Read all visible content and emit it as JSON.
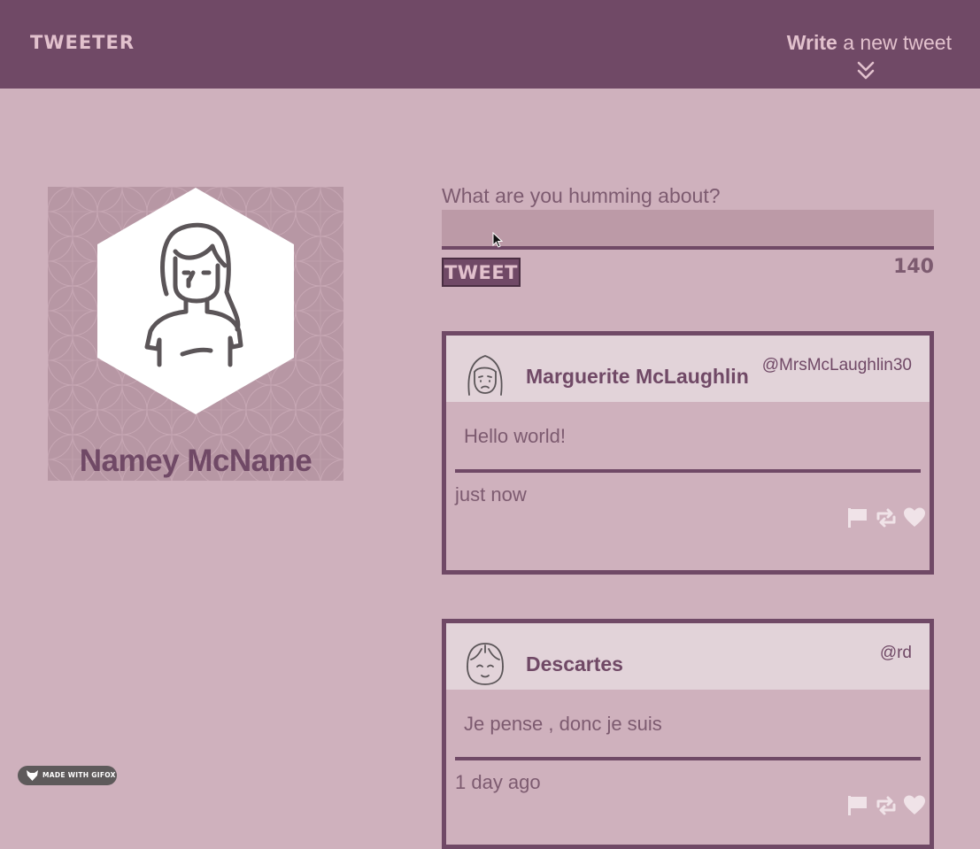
{
  "navbar": {
    "brand": "TWEETER",
    "compose_bold": "Write",
    "compose_rest": " a new tweet",
    "compose_icon": "double-chevron-down-icon"
  },
  "profile": {
    "name": "Namey McName",
    "avatar_icon": "woman-avatar-icon"
  },
  "composer": {
    "label": "What are you humming about?",
    "input_value": "",
    "button_label": "TWEET",
    "counter": "140"
  },
  "tweets": [
    {
      "name": "Marguerite McLaughlin",
      "handle": "@MrsMcLaughlin30",
      "text": "Hello world!",
      "time": "just now",
      "avatar_icon": "sad-woman-avatar-icon"
    },
    {
      "name": "Descartes",
      "handle": "@rd",
      "text": "Je pense , donc je suis",
      "time": "1 day ago",
      "avatar_icon": "smiling-child-avatar-icon"
    }
  ],
  "tweet_actions": [
    "flag-icon",
    "retweet-icon",
    "heart-icon"
  ],
  "badge": {
    "label": "MADE WITH GIFOX"
  },
  "colors": {
    "page_bg": "#cfb1bd",
    "navbar_bg": "#704966",
    "accent": "#704966",
    "light_text": "#e2c1cd",
    "muted_text": "#7d5b70",
    "tweet_header_bg": "#e2d3d9"
  }
}
